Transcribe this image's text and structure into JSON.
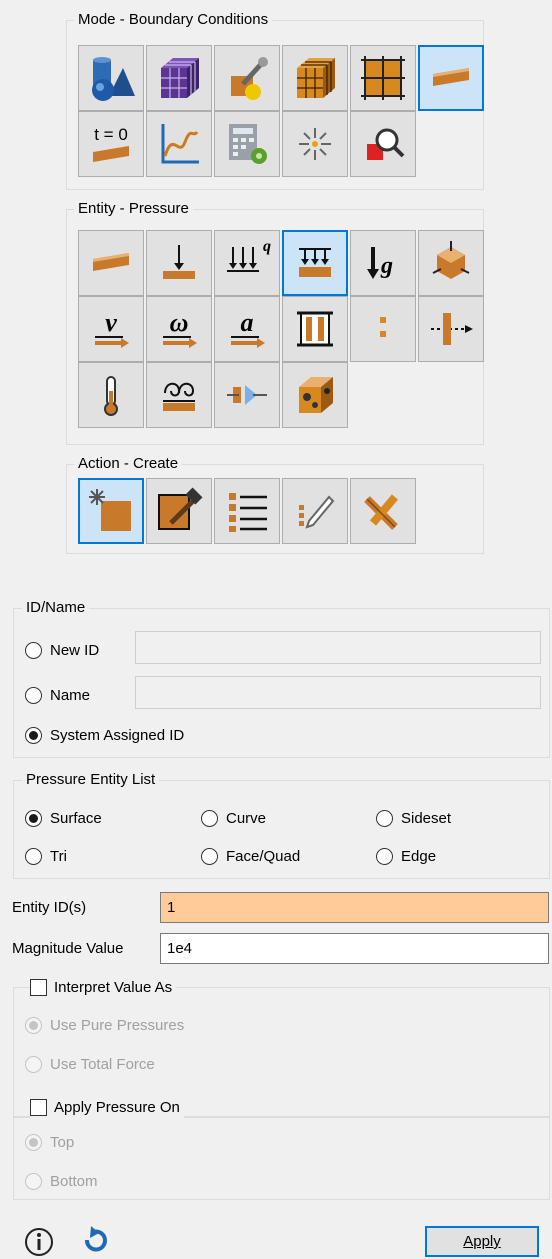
{
  "mode": {
    "legend": "Mode - Boundary Conditions",
    "buttons": [
      {
        "icon": "geometry-icon"
      },
      {
        "icon": "mesh-icon"
      },
      {
        "icon": "tools-icon"
      },
      {
        "icon": "hex-mesh-icon"
      },
      {
        "icon": "grid-icon"
      },
      {
        "icon": "boundary-conditions-icon"
      },
      {
        "icon": "initial-conditions-icon",
        "text": "t = 0"
      },
      {
        "icon": "curve-plot-icon"
      },
      {
        "icon": "calculator-icon"
      },
      {
        "icon": "sparkle-icon"
      },
      {
        "icon": "inspect-icon"
      }
    ],
    "selected_index": 5
  },
  "entity": {
    "legend": "Entity - Pressure",
    "buttons": [
      {
        "icon": "pressure-surface-icon"
      },
      {
        "icon": "force-icon"
      },
      {
        "icon": "heat-flux-icon",
        "text": "q"
      },
      {
        "icon": "pressure-icon"
      },
      {
        "icon": "gravity-icon",
        "text": "g"
      },
      {
        "icon": "displacement-icon"
      },
      {
        "icon": "velocity-icon",
        "text": "ν"
      },
      {
        "icon": "angular-velocity-icon",
        "text": "ω"
      },
      {
        "icon": "acceleration-icon",
        "text": "a"
      },
      {
        "icon": "contact-icon"
      },
      {
        "icon": "dashed-bar-icon"
      },
      {
        "icon": "constraint-icon"
      },
      {
        "icon": "temperature-icon"
      },
      {
        "icon": "convection-icon"
      },
      {
        "icon": "radiation-icon"
      },
      {
        "icon": "material-block-icon"
      }
    ],
    "selected_index": 3
  },
  "action": {
    "legend": "Action - Create",
    "buttons": [
      {
        "icon": "create-icon"
      },
      {
        "icon": "modify-icon"
      },
      {
        "icon": "list-icon"
      },
      {
        "icon": "edit-icon"
      },
      {
        "icon": "delete-icon"
      }
    ],
    "selected_index": 0
  },
  "id_name": {
    "legend": "ID/Name",
    "options": [
      {
        "label": "New ID",
        "selected": false
      },
      {
        "label": "Name",
        "selected": false
      },
      {
        "label": "System Assigned ID",
        "selected": true
      }
    ],
    "new_id_value": "",
    "name_value": ""
  },
  "entity_list": {
    "legend": "Pressure Entity List",
    "options": [
      "Surface",
      "Curve",
      "Sideset",
      "Tri",
      "Face/Quad",
      "Edge"
    ],
    "selected": "Surface"
  },
  "entity_ids": {
    "label": "Entity ID(s)",
    "value": "1"
  },
  "magnitude": {
    "label": "Magnitude Value",
    "value": "1e4"
  },
  "interpret": {
    "label": "Interpret Value As",
    "checked": false,
    "options": [
      "Use Pure Pressures",
      "Use Total Force"
    ],
    "selected": "Use Pure Pressures",
    "enabled": false
  },
  "apply_on": {
    "label": "Apply Pressure On",
    "checked": false,
    "options": [
      "Top",
      "Bottom"
    ],
    "selected": "Top",
    "enabled": false
  },
  "footer": {
    "apply_label": "Apply",
    "info_icon": "info-icon",
    "reset_icon": "reset-icon"
  },
  "colors": {
    "accent": "#0078d7",
    "highlight_field": "#ffcc99",
    "surface_orange": "#c87a2a"
  }
}
